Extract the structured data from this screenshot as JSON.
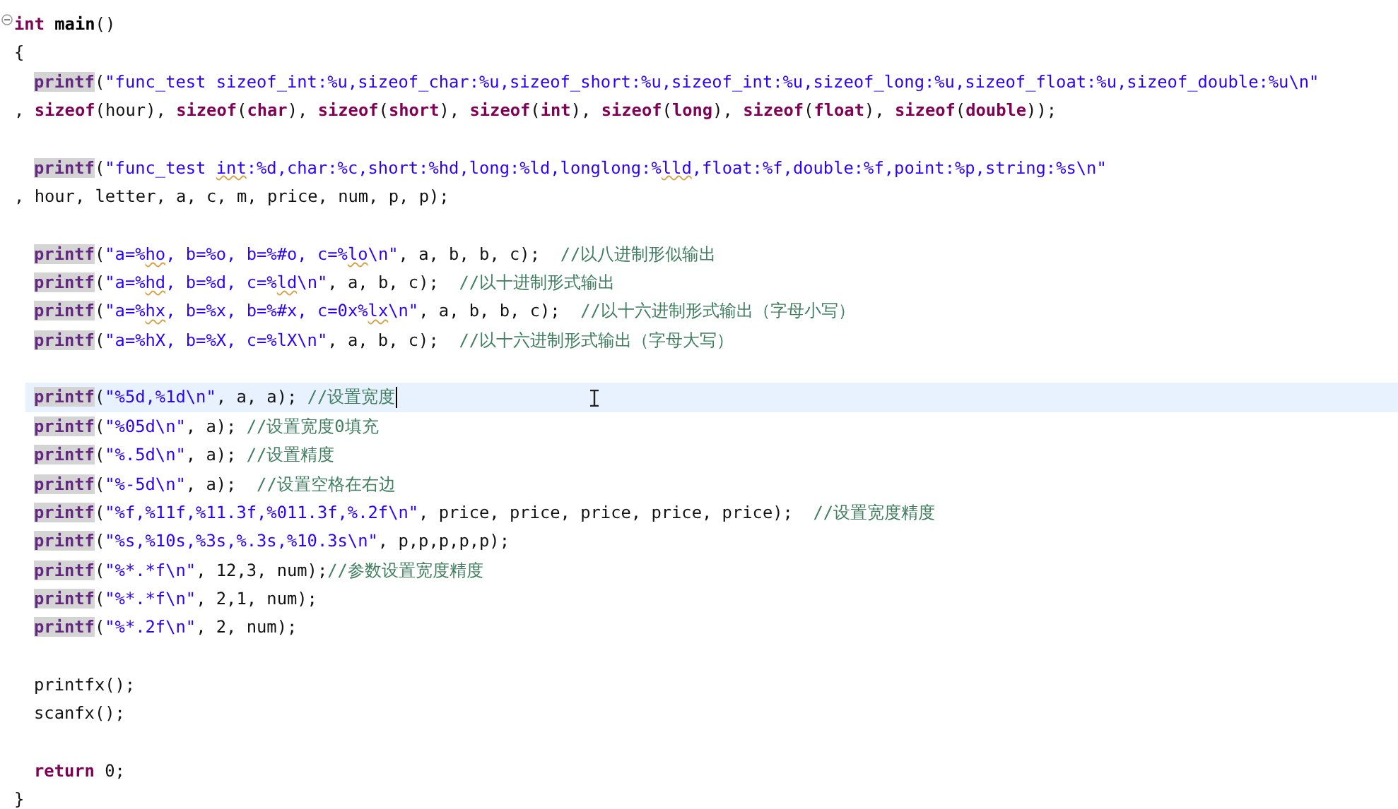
{
  "editor": {
    "lines": [
      {
        "indented": false,
        "current": false,
        "expanded": true,
        "tokens": [
          {
            "kind": "keyword",
            "text": "int "
          },
          {
            "kind": "name",
            "text": "main"
          },
          {
            "kind": "plain",
            "text": "()"
          }
        ]
      },
      {
        "indented": false,
        "current": false,
        "tokens": [
          {
            "kind": "plain",
            "text": "{"
          }
        ]
      },
      {
        "indented": true,
        "current": false,
        "tokens": [
          {
            "kind": "call",
            "text": "printf"
          },
          {
            "kind": "plain",
            "text": "("
          },
          {
            "kind": "string",
            "text": "\"func_test sizeof_int:%u,sizeof_char:%u,sizeof_short:%u,sizeof_int:%u,sizeof_long:%u,sizeof_float:%u,sizeof_double:%u\\n\""
          }
        ]
      },
      {
        "indented": false,
        "current": false,
        "tokens": [
          {
            "kind": "plain",
            "text": ", "
          },
          {
            "kind": "keyword",
            "text": "sizeof"
          },
          {
            "kind": "plain",
            "text": "(hour), "
          },
          {
            "kind": "keyword",
            "text": "sizeof"
          },
          {
            "kind": "plain",
            "text": "("
          },
          {
            "kind": "keyword",
            "text": "char"
          },
          {
            "kind": "plain",
            "text": "), "
          },
          {
            "kind": "keyword",
            "text": "sizeof"
          },
          {
            "kind": "plain",
            "text": "("
          },
          {
            "kind": "keyword",
            "text": "short"
          },
          {
            "kind": "plain",
            "text": "), "
          },
          {
            "kind": "keyword",
            "text": "sizeof"
          },
          {
            "kind": "plain",
            "text": "("
          },
          {
            "kind": "keyword",
            "text": "int"
          },
          {
            "kind": "plain",
            "text": "), "
          },
          {
            "kind": "keyword",
            "text": "sizeof"
          },
          {
            "kind": "plain",
            "text": "("
          },
          {
            "kind": "keyword",
            "text": "long"
          },
          {
            "kind": "plain",
            "text": "), "
          },
          {
            "kind": "keyword",
            "text": "sizeof"
          },
          {
            "kind": "plain",
            "text": "("
          },
          {
            "kind": "keyword",
            "text": "float"
          },
          {
            "kind": "plain",
            "text": "), "
          },
          {
            "kind": "keyword",
            "text": "sizeof"
          },
          {
            "kind": "plain",
            "text": "("
          },
          {
            "kind": "keyword",
            "text": "double"
          },
          {
            "kind": "plain",
            "text": "));"
          }
        ]
      },
      {
        "current": false
      },
      {
        "indented": true,
        "current": false,
        "tokens": [
          {
            "kind": "call",
            "text": "printf"
          },
          {
            "kind": "plain",
            "text": "("
          },
          {
            "kind": "string",
            "text": "\"func_test "
          },
          {
            "kind": "flagged",
            "text": "int"
          },
          {
            "kind": "string",
            "text": ":%d,char:%c,short:%hd,long:%ld,longlong:%"
          },
          {
            "kind": "flagged",
            "text": "lld"
          },
          {
            "kind": "string",
            "text": ",float:%f,double:%f,point:%p,string:%s\\n\""
          }
        ]
      },
      {
        "indented": false,
        "current": false,
        "tokens": [
          {
            "kind": "plain",
            "text": ", hour, letter, a, c, m, price, num, p, p);"
          }
        ]
      },
      {
        "current": false
      },
      {
        "indented": true,
        "current": false,
        "tokens": [
          {
            "kind": "call",
            "text": "printf"
          },
          {
            "kind": "plain",
            "text": "("
          },
          {
            "kind": "string",
            "text": "\"a=%"
          },
          {
            "kind": "flagged",
            "text": "ho"
          },
          {
            "kind": "string",
            "text": ", b=%o, b=%#o, c=%"
          },
          {
            "kind": "flagged",
            "text": "lo"
          },
          {
            "kind": "string",
            "text": "\\n\""
          },
          {
            "kind": "plain",
            "text": ", a, b, b, c);  "
          },
          {
            "kind": "comment",
            "text": "//以八进制形似输出"
          }
        ]
      },
      {
        "indented": true,
        "current": false,
        "tokens": [
          {
            "kind": "call",
            "text": "printf"
          },
          {
            "kind": "plain",
            "text": "("
          },
          {
            "kind": "string",
            "text": "\"a=%"
          },
          {
            "kind": "flagged",
            "text": "hd"
          },
          {
            "kind": "string",
            "text": ", b=%d, c=%"
          },
          {
            "kind": "flagged",
            "text": "ld"
          },
          {
            "kind": "string",
            "text": "\\n\""
          },
          {
            "kind": "plain",
            "text": ", a, b, c);  "
          },
          {
            "kind": "comment",
            "text": "//以十进制形式输出"
          }
        ]
      },
      {
        "indented": true,
        "current": false,
        "tokens": [
          {
            "kind": "call",
            "text": "printf"
          },
          {
            "kind": "plain",
            "text": "("
          },
          {
            "kind": "string",
            "text": "\"a=%"
          },
          {
            "kind": "flagged",
            "text": "hx"
          },
          {
            "kind": "string",
            "text": ", b=%x, b=%#x, c=0x%"
          },
          {
            "kind": "flagged",
            "text": "lx"
          },
          {
            "kind": "string",
            "text": "\\n\""
          },
          {
            "kind": "plain",
            "text": ", a, b, b, c);  "
          },
          {
            "kind": "comment",
            "text": "//以十六进制形式输出（字母小写）"
          }
        ]
      },
      {
        "indented": true,
        "current": false,
        "tokens": [
          {
            "kind": "call",
            "text": "printf"
          },
          {
            "kind": "plain",
            "text": "("
          },
          {
            "kind": "string",
            "text": "\"a=%hX, b=%X, c=%lX\\n\""
          },
          {
            "kind": "plain",
            "text": ", a, b, c);  "
          },
          {
            "kind": "comment",
            "text": "//以十六进制形式输出（字母大写）"
          }
        ]
      },
      {
        "current": false
      },
      {
        "indented": true,
        "current": true,
        "tokens": [
          {
            "kind": "call",
            "text": "printf"
          },
          {
            "kind": "plain",
            "text": "("
          },
          {
            "kind": "string",
            "text": "\"%5d,%1d\\n\""
          },
          {
            "kind": "plain",
            "text": ", a, a); "
          },
          {
            "kind": "comment",
            "text": "//设置宽度"
          }
        ]
      },
      {
        "indented": true,
        "current": false,
        "tokens": [
          {
            "kind": "call",
            "text": "printf"
          },
          {
            "kind": "plain",
            "text": "("
          },
          {
            "kind": "string",
            "text": "\"%05d\\n\""
          },
          {
            "kind": "plain",
            "text": ", a); "
          },
          {
            "kind": "comment",
            "text": "//设置宽度0填充"
          }
        ]
      },
      {
        "indented": true,
        "current": false,
        "tokens": [
          {
            "kind": "call",
            "text": "printf"
          },
          {
            "kind": "plain",
            "text": "("
          },
          {
            "kind": "string",
            "text": "\"%.5d\\n\""
          },
          {
            "kind": "plain",
            "text": ", a); "
          },
          {
            "kind": "comment",
            "text": "//设置精度"
          }
        ]
      },
      {
        "indented": true,
        "current": false,
        "tokens": [
          {
            "kind": "call",
            "text": "printf"
          },
          {
            "kind": "plain",
            "text": "("
          },
          {
            "kind": "string",
            "text": "\"%-5d\\n\""
          },
          {
            "kind": "plain",
            "text": ", a);  "
          },
          {
            "kind": "comment",
            "text": "//设置空格在右边"
          }
        ]
      },
      {
        "indented": true,
        "current": false,
        "tokens": [
          {
            "kind": "call",
            "text": "printf"
          },
          {
            "kind": "plain",
            "text": "("
          },
          {
            "kind": "string",
            "text": "\"%f,%11f,%11.3f,%011.3f,%.2f\\n\""
          },
          {
            "kind": "plain",
            "text": ", price, price, price, price, price);  "
          },
          {
            "kind": "comment",
            "text": "//设置宽度精度"
          }
        ]
      },
      {
        "indented": true,
        "current": false,
        "tokens": [
          {
            "kind": "call",
            "text": "printf"
          },
          {
            "kind": "plain",
            "text": "("
          },
          {
            "kind": "string",
            "text": "\"%s,%10s,%3s,%.3s,%10.3s\\n\""
          },
          {
            "kind": "plain",
            "text": ", p,p,p,p,p);"
          }
        ]
      },
      {
        "indented": true,
        "current": false,
        "tokens": [
          {
            "kind": "call",
            "text": "printf"
          },
          {
            "kind": "plain",
            "text": "("
          },
          {
            "kind": "string",
            "text": "\"%*.*f\\n\""
          },
          {
            "kind": "plain",
            "text": ", 12,3, num);"
          },
          {
            "kind": "comment",
            "text": "//参数设置宽度精度"
          }
        ]
      },
      {
        "indented": true,
        "current": false,
        "tokens": [
          {
            "kind": "call",
            "text": "printf"
          },
          {
            "kind": "plain",
            "text": "("
          },
          {
            "kind": "string",
            "text": "\"%*.*f\\n\""
          },
          {
            "kind": "plain",
            "text": ", 2,1, num);"
          }
        ]
      },
      {
        "indented": true,
        "current": false,
        "tokens": [
          {
            "kind": "call",
            "text": "printf"
          },
          {
            "kind": "plain",
            "text": "("
          },
          {
            "kind": "string",
            "text": "\"%*.2f\\n\""
          },
          {
            "kind": "plain",
            "text": ", 2, num);"
          }
        ]
      },
      {
        "current": false
      },
      {
        "indented": true,
        "current": false,
        "tokens": [
          {
            "kind": "plain",
            "text": "printfx();"
          }
        ]
      },
      {
        "indented": true,
        "current": false,
        "tokens": [
          {
            "kind": "plain",
            "text": "scanfx();"
          }
        ]
      },
      {
        "current": false
      },
      {
        "indented": true,
        "current": false,
        "tokens": [
          {
            "kind": "keyword",
            "text": "return"
          },
          {
            "kind": "plain",
            "text": " 0;"
          }
        ]
      },
      {
        "indented": false,
        "current": false,
        "tokens": [
          {
            "kind": "plain",
            "text": "}"
          }
        ]
      }
    ]
  }
}
